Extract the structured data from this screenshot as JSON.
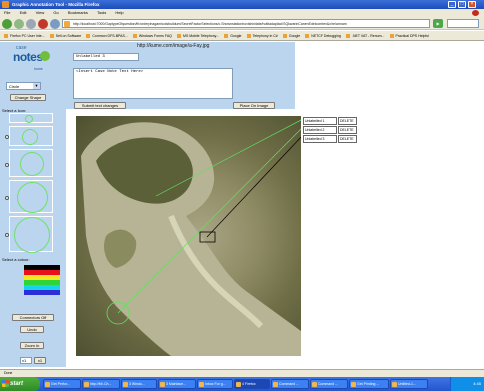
{
  "window": {
    "title": "Graphic Annotation Tool - Mozilla Firefox"
  },
  "menu": [
    "File",
    "Edit",
    "View",
    "Go",
    "Bookmarks",
    "Tools",
    "Help"
  ],
  "toolbar": {
    "url": "http://localhost:7000/GaptypeOfquestion/fir/orderphagamicoisbuildum/SecretFactorSelections/c.Shownstationhovishinilate/hotitadaplaci/SQkwarinCanenEdelcomtex&x/re/annam"
  },
  "bookmarks": [
    "Firefox PC User Inte...",
    "Sell on Software",
    "Common DFS-BPAS...",
    "Windows Forms FAQ",
    "MS Mobile Telephony...",
    "Google",
    "Telephony in C#",
    "Google",
    "NETCF Debugging",
    ".NET VAT - Renum...",
    "Practical DPS Helpful"
  ],
  "header": {
    "image_url": "http://kume.com/image/a-Fay.jpg"
  },
  "logo": {
    "line1": "case",
    "line2": "notes",
    "line3": "home"
  },
  "editor": {
    "label_value": "Unlabelled 3",
    "notes_value": "<Insert Case Note Text Here>",
    "submit_label": "Submit text changes",
    "place_label": "Place On Image"
  },
  "left": {
    "shape_select": "Circle",
    "change_shape_label": "Change Shape",
    "select_icon_label": "Select a Icon:",
    "select_colour_label": "Select a colour:",
    "colours": [
      "#000000",
      "#e8101a",
      "#f6e521",
      "#2fd43a",
      "#16d3ee",
      "#2a2fd9"
    ],
    "connectors_label": "Connectors Off",
    "undo_label": "Undo",
    "zoom_label": "Zoom In",
    "zoom_value": "x1",
    "zoom_apply": "x1"
  },
  "labels": [
    {
      "name": "Unlabelled 1",
      "action": "DELETE"
    },
    {
      "name": "Unlabelled 2",
      "action": "DELETE"
    },
    {
      "name": "Unlabelled 3",
      "action": "DELETE"
    }
  ],
  "status": {
    "text": "Done"
  },
  "taskbar": {
    "start": "start",
    "tasks": [
      "Get Perfor...",
      "http://Mr-Ch...",
      "3 Windo...",
      "3 Mainface...",
      "Inbox For g...",
      "4 Firefox",
      "Command ...",
      "Command ...",
      "Get Printing ...",
      "Untitled-1..."
    ],
    "clock": "4:45"
  }
}
